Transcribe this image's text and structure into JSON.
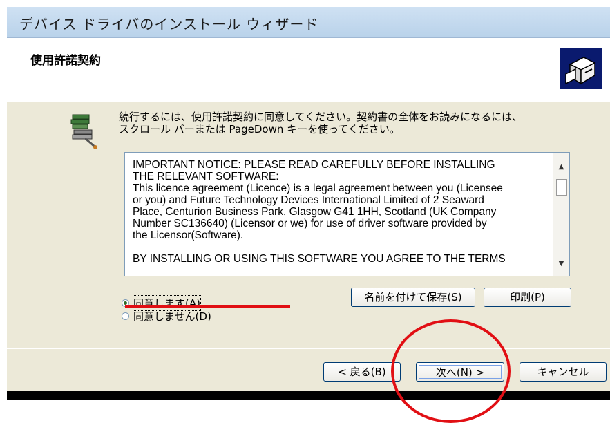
{
  "window": {
    "title": "デバイス ドライバのインストール ウィザード"
  },
  "header": {
    "title": "使用許諾契約",
    "icon": "driver-install-icon"
  },
  "instruction": {
    "line1": "続行するには、使用許諾契約に同意してください。契約書の全体をお読みになるには、",
    "line2": "スクロール バーまたは PageDown キーを使ってください。",
    "icon": "driver-package-icon"
  },
  "license": {
    "paragraph1": "IMPORTANT NOTICE: PLEASE READ CAREFULLY BEFORE INSTALLING\nTHE RELEVANT SOFTWARE:\nThis licence agreement (Licence) is a legal agreement between you (Licensee\nor you) and Future Technology Devices International Limited of 2 Seaward\nPlace, Centurion Business Park, Glasgow G41 1HH, Scotland (UK Company\nNumber SC136640) (Licensor or we) for use of driver software provided by\nthe Licensor(Software).",
    "paragraph2": "BY INSTALLING OR USING THIS SOFTWARE YOU AGREE TO THE TERMS"
  },
  "options": {
    "agree_label": "同意します(A)",
    "disagree_label": "同意しません(D)",
    "selected": "agree"
  },
  "buttons": {
    "save": "名前を付けて保存(S)",
    "print": "印刷(P)",
    "back": "< 戻る(B)",
    "next": "次へ(N) >",
    "cancel": "キャンセル"
  },
  "colors": {
    "annotation_red": "#e10f14",
    "dialog_bg": "#ece9d8",
    "header_icon_bg": "#0a1a6e"
  }
}
